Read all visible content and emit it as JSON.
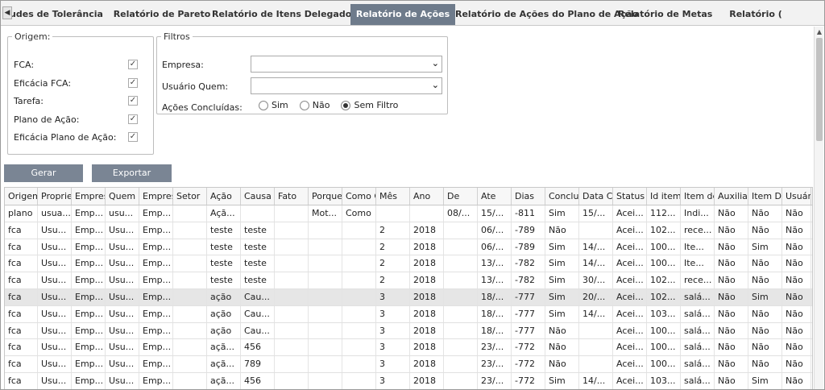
{
  "tabs": [
    {
      "label": "udes de Tolerância",
      "active": false
    },
    {
      "label": "Relatório de Pareto",
      "active": false
    },
    {
      "label": "Relatório de Itens Delegados",
      "active": false
    },
    {
      "label": "Relatório de Ações",
      "active": true
    },
    {
      "label": "Relatório de Ações do Plano de Ação",
      "active": false
    },
    {
      "label": "Relatório de Metas",
      "active": false
    },
    {
      "label": "Relatório (",
      "active": false
    }
  ],
  "origem": {
    "legend": "Origem:",
    "items": [
      {
        "label": "FCA:",
        "checked": true
      },
      {
        "label": "Eficácia FCA:",
        "checked": true
      },
      {
        "label": "Tarefa:",
        "checked": true
      },
      {
        "label": "Plano de Ação:",
        "checked": true
      },
      {
        "label": "Eficácia Plano de Ação:",
        "checked": true
      }
    ]
  },
  "filtros": {
    "legend": "Filtros",
    "empresa_label": "Empresa:",
    "empresa_value": "",
    "usuario_label": "Usuário Quem:",
    "usuario_value": "",
    "acoes_label": "Ações Concluídas:",
    "radio": [
      {
        "label": "Sim",
        "selected": false
      },
      {
        "label": "Não",
        "selected": false
      },
      {
        "label": "Sem Filtro",
        "selected": true
      }
    ]
  },
  "buttons": {
    "gerar": "Gerar",
    "exportar": "Exportar"
  },
  "table": {
    "columns": [
      "Origem",
      "Proprie",
      "Empres",
      "Quem",
      "Empres",
      "Setor",
      "Ação",
      "Causa",
      "Fato",
      "Porque",
      "Como C",
      "Mês",
      "Ano",
      "De",
      "Ate",
      "Dias",
      "Conclu",
      "Data Co",
      "Status",
      "Id item",
      "Item de",
      "Auxiliar",
      "Item De",
      "Usuário"
    ],
    "rows": [
      [
        "plano",
        "usua...",
        "Emp...",
        "usu...",
        "Emp...",
        "",
        "Açã...",
        "",
        "",
        "Mot...",
        "Como",
        "",
        "",
        "08/...",
        "15/...",
        "-811",
        "Sim",
        "15/...",
        "Acei...",
        "112...",
        "Indi...",
        "Não",
        "Não",
        "Não"
      ],
      [
        "fca",
        "Usu...",
        "Emp...",
        "Usu...",
        "Emp...",
        "",
        "teste",
        "teste",
        "",
        "",
        "",
        "2",
        "2018",
        "",
        "06/...",
        "-789",
        "Não",
        "",
        "Acei...",
        "102...",
        "rece...",
        "Não",
        "Não",
        "Não"
      ],
      [
        "fca",
        "Usu...",
        "Emp...",
        "Usu...",
        "Emp...",
        "",
        "teste",
        "teste",
        "",
        "",
        "",
        "2",
        "2018",
        "",
        "06/...",
        "-789",
        "Sim",
        "14/...",
        "Acei...",
        "100...",
        "Ite...",
        "Não",
        "Sim",
        "Não"
      ],
      [
        "fca",
        "Usu...",
        "Emp...",
        "Usu...",
        "Emp...",
        "",
        "teste",
        "teste",
        "",
        "",
        "",
        "2",
        "2018",
        "",
        "13/...",
        "-782",
        "Sim",
        "14/...",
        "Acei...",
        "100...",
        "Ite...",
        "Não",
        "Não",
        "Não"
      ],
      [
        "fca",
        "Usu...",
        "Emp...",
        "Usu...",
        "Emp...",
        "",
        "teste",
        "teste",
        "",
        "",
        "",
        "2",
        "2018",
        "",
        "13/...",
        "-782",
        "Sim",
        "30/...",
        "Acei...",
        "102...",
        "rece...",
        "Não",
        "Não",
        "Não"
      ],
      [
        "fca",
        "Usu...",
        "Emp...",
        "Usu...",
        "Emp...",
        "",
        "ação",
        "Cau...",
        "",
        "",
        "",
        "3",
        "2018",
        "",
        "18/...",
        "-777",
        "Sim",
        "20/...",
        "Acei...",
        "102...",
        "salá...",
        "Não",
        "Sim",
        "Não"
      ],
      [
        "fca",
        "Usu...",
        "Emp...",
        "Usu...",
        "Emp...",
        "",
        "ação",
        "Cau...",
        "",
        "",
        "",
        "3",
        "2018",
        "",
        "18/...",
        "-777",
        "Sim",
        "14/...",
        "Acei...",
        "103...",
        "salá...",
        "Não",
        "Não",
        "Não"
      ],
      [
        "fca",
        "Usu...",
        "Emp...",
        "Usu...",
        "Emp...",
        "",
        "ação",
        "Cau...",
        "",
        "",
        "",
        "3",
        "2018",
        "",
        "18/...",
        "-777",
        "Não",
        "",
        "Acei...",
        "100...",
        "salá...",
        "Não",
        "Não",
        "Não"
      ],
      [
        "fca",
        "Usu...",
        "Emp...",
        "Usu...",
        "Emp...",
        "",
        "açã...",
        "456",
        "",
        "",
        "",
        "3",
        "2018",
        "",
        "23/...",
        "-772",
        "Não",
        "",
        "Acei...",
        "100...",
        "salá...",
        "Não",
        "Não",
        "Não"
      ],
      [
        "fca",
        "Usu...",
        "Emp...",
        "Usu...",
        "Emp...",
        "",
        "açã...",
        "789",
        "",
        "",
        "",
        "3",
        "2018",
        "",
        "23/...",
        "-772",
        "Não",
        "",
        "Acei...",
        "100...",
        "salá...",
        "Não",
        "Não",
        "Não"
      ],
      [
        "fca",
        "Usu...",
        "Emp...",
        "Usu...",
        "Emp...",
        "",
        "açã...",
        "456",
        "",
        "",
        "",
        "3",
        "2018",
        "",
        "23/...",
        "-772",
        "Sim",
        "14/...",
        "Acei...",
        "103...",
        "salá...",
        "Não",
        "Sim",
        "Não"
      ]
    ],
    "selected_row": 5
  }
}
